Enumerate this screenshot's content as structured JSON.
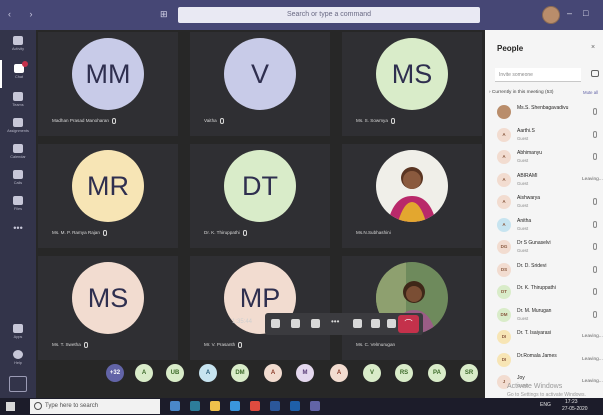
{
  "titlebar": {
    "search_placeholder": "Search or type a command",
    "nav": "‹ ›",
    "grid": "⊞",
    "minimize": "–",
    "maximize": "□"
  },
  "rail": {
    "items": [
      {
        "label": "Activity"
      },
      {
        "label": "Chat"
      },
      {
        "label": "Teams"
      },
      {
        "label": "Assignments"
      },
      {
        "label": "Calendar"
      },
      {
        "label": "Calls"
      },
      {
        "label": "Files"
      }
    ],
    "more": "•••",
    "bottom": [
      {
        "label": "Apps"
      },
      {
        "label": "Help"
      }
    ]
  },
  "tiles": [
    {
      "initials": "MM",
      "name": "Madhan Prasad Manoharan",
      "bg": "#c8cbe8"
    },
    {
      "initials": "V",
      "name": "Vaitha",
      "bg": "#c8cbe8"
    },
    {
      "initials": "MS",
      "name": "Ms. S. Sowmya",
      "bg": "#d9ecc9"
    },
    {
      "initials": "MR",
      "name": "Ms. M. P. Ramya Rajan",
      "bg": "#f7e5b5"
    },
    {
      "initials": "DT",
      "name": "Dr. K. Thiruppathi",
      "bg": "#d9ecc9"
    },
    {
      "initials": "",
      "name": "Ms.N.Subhashini",
      "bg": "#b46a4a"
    },
    {
      "initials": "MS",
      "name": "Ms. T. Swetha",
      "bg": "#f2dcd0"
    },
    {
      "initials": "MP",
      "name": "Mr. V. Prasanth",
      "bg": "#f2dcd0"
    },
    {
      "initials": "",
      "name": "Ms. C. Velmurugan",
      "bg": "#7c8f6a"
    }
  ],
  "call": {
    "timer": "1:35:44",
    "buttons": [
      "video",
      "mic",
      "share",
      "more",
      "raise-hand",
      "chat",
      "participants"
    ],
    "hangup": "⌒"
  },
  "strip": {
    "chips": [
      {
        "text": "+32",
        "bg": "#6264a7",
        "fg": "#ffffff"
      },
      {
        "text": "A",
        "bg": "#d9ecc9",
        "fg": "#3d6b2a"
      },
      {
        "text": "UB",
        "bg": "#d9ecc9",
        "fg": "#3d6b2a"
      },
      {
        "text": "A",
        "bg": "#c7e4f0",
        "fg": "#2a5d78"
      },
      {
        "text": "DM",
        "bg": "#d9ecc9",
        "fg": "#3d6b2a"
      },
      {
        "text": "A",
        "bg": "#f2dcd0",
        "fg": "#8a3a28"
      },
      {
        "text": "M",
        "bg": "#e4d8ee",
        "fg": "#5a3d78"
      },
      {
        "text": "A",
        "bg": "#f2dcd0",
        "fg": "#8a3a28"
      },
      {
        "text": "V",
        "bg": "#d9ecc9",
        "fg": "#3d6b2a"
      },
      {
        "text": "RS",
        "bg": "#d9ecc9",
        "fg": "#3d6b2a"
      },
      {
        "text": "PA",
        "bg": "#d9ecc9",
        "fg": "#3d6b2a"
      },
      {
        "text": "SR",
        "bg": "#d9ecc9",
        "fg": "#3d6b2a"
      }
    ]
  },
  "people": {
    "title": "People",
    "close": "×",
    "invite_placeholder": "Invite someone",
    "section": "› Currently in this meeting (53)",
    "mute_all": "Mute all",
    "list": [
      {
        "initials": "",
        "name": "Ms.S. Shenbagavadivu",
        "role": "",
        "state": "",
        "bg": "#b98d6b"
      },
      {
        "initials": "A",
        "name": "Aarthi.S",
        "role": "Guest",
        "state": "",
        "bg": "#f2dcd0"
      },
      {
        "initials": "A",
        "name": "Abhimanyu",
        "role": "Guest",
        "state": "",
        "bg": "#f2dcd0"
      },
      {
        "initials": "A",
        "name": "ABIRAMI",
        "role": "Guest",
        "state": "Leaving...",
        "bg": "#f2dcd0"
      },
      {
        "initials": "A",
        "name": "Aishwarya",
        "role": "Guest",
        "state": "",
        "bg": "#f2dcd0"
      },
      {
        "initials": "A",
        "name": "Anitha",
        "role": "Guest",
        "state": "",
        "bg": "#c7e4f0"
      },
      {
        "initials": "DG",
        "name": "Dr S Gunaselvi",
        "role": "Guest",
        "state": "",
        "bg": "#f2dcd0"
      },
      {
        "initials": "DS",
        "name": "Dr. D. Sridevi",
        "role": "",
        "state": "",
        "bg": "#f2dcd0"
      },
      {
        "initials": "DT",
        "name": "Dr. K. Thiruppathi",
        "role": "",
        "state": "",
        "bg": "#d9ecc9"
      },
      {
        "initials": "DM",
        "name": "Dr. M. Murugan",
        "role": "Guest",
        "state": "",
        "bg": "#d9ecc9"
      },
      {
        "initials": "DI",
        "name": "Dr. T. Isaiyarasi",
        "role": "",
        "state": "Leaving...",
        "bg": "#f7e5b5"
      },
      {
        "initials": "DI",
        "name": "Dr.Romala James",
        "role": "",
        "state": "Leaving...",
        "bg": "#f7e5b5"
      },
      {
        "initials": "J",
        "name": "Joy",
        "role": "Guest",
        "state": "Leaving...",
        "bg": "#f2dcd0"
      }
    ],
    "activate_title": "Activate Windows",
    "activate_sub": "Go to Settings to activate Windows."
  },
  "taskbar": {
    "search_placeholder": "Type here to search",
    "lang": "ENG",
    "time": "17:23",
    "date": "27-05-2020"
  }
}
